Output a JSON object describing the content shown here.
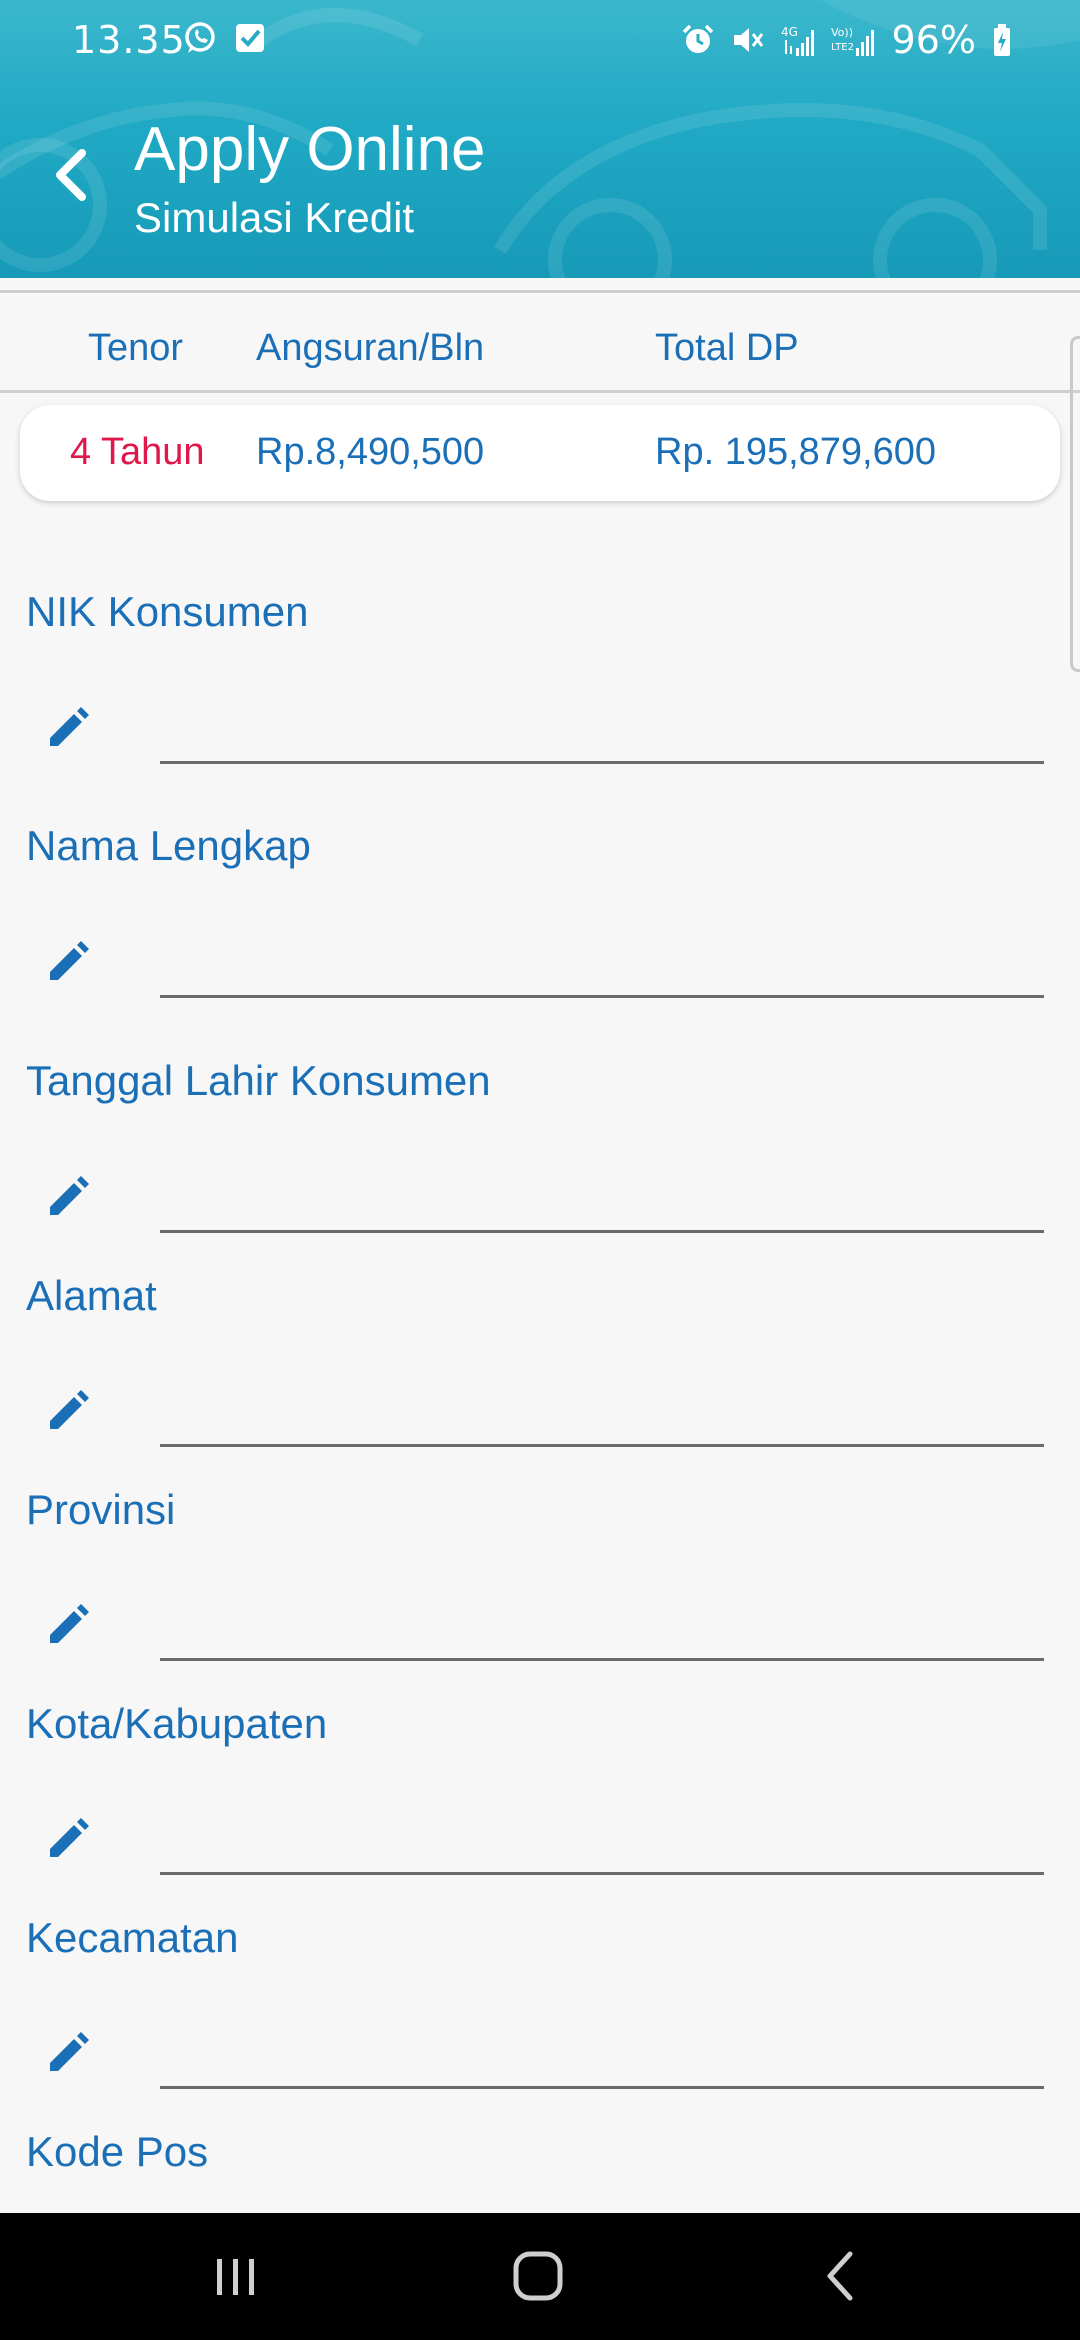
{
  "status_bar": {
    "time": "13.35",
    "battery": "96%",
    "network_4g": "4G",
    "network_volte": "Vo))",
    "network_lte2": "LTE2"
  },
  "app_bar": {
    "title": "Apply Online",
    "subtitle": "Simulasi Kredit",
    "back_icon": "chevron-left-icon"
  },
  "summary": {
    "headers": {
      "tenor": "Tenor",
      "angsuran": "Angsuran/Bln",
      "total_dp": "Total DP"
    },
    "values": {
      "tenor": "4 Tahun",
      "angsuran": "Rp.8,490,500",
      "total_dp": "Rp. 195,879,600"
    }
  },
  "form": {
    "fields": [
      {
        "label": "NIK Konsumen",
        "value": ""
      },
      {
        "label": "Nama Lengkap",
        "value": ""
      },
      {
        "label": "Tanggal Lahir Konsumen",
        "value": ""
      },
      {
        "label": "Alamat",
        "value": ""
      },
      {
        "label": "Provinsi",
        "value": ""
      },
      {
        "label": "Kota/Kabupaten",
        "value": ""
      },
      {
        "label": "Kecamatan",
        "value": ""
      },
      {
        "label": "Kode Pos",
        "value": ""
      }
    ],
    "edit_icon": "pencil-icon"
  },
  "colors": {
    "header_teal": "#20a9c4",
    "label_blue": "#1b6fb6",
    "tenor_red": "#e0174a",
    "background": "#f7f7f7",
    "navbar": "#000000"
  },
  "nav_bar": {
    "recents_icon": "recents-icon",
    "home_icon": "home-icon",
    "back_icon": "back-icon"
  }
}
